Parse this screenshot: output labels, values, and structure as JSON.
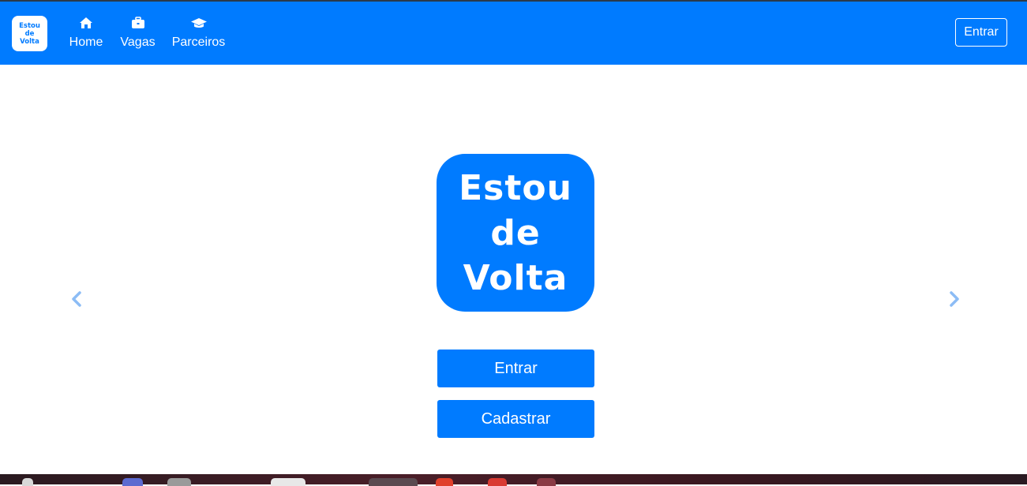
{
  "nav": {
    "logo_lines": [
      "Estou",
      "de",
      "Volta"
    ],
    "items": [
      {
        "label": "Home",
        "icon": "home-icon"
      },
      {
        "label": "Vagas",
        "icon": "briefcase-icon"
      },
      {
        "label": "Parceiros",
        "icon": "graduation-cap-icon"
      }
    ],
    "enter_label": "Entrar"
  },
  "hero": {
    "logo_lines": [
      "Estou",
      "de",
      "Volta"
    ],
    "enter_button": "Entrar",
    "signup_button": "Cadastrar"
  },
  "carousel": {
    "prev_icon": "chevron-left-icon",
    "next_icon": "chevron-right-icon"
  },
  "colors": {
    "primary": "#007bff",
    "arrow": "#8cbcf5",
    "white": "#ffffff"
  }
}
